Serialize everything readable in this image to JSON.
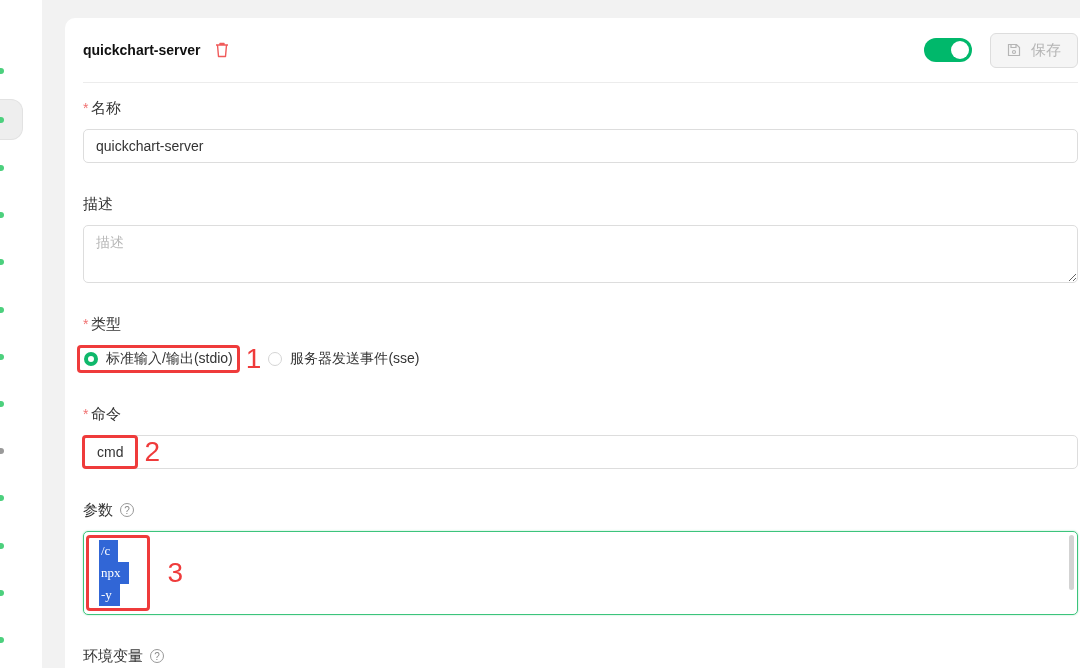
{
  "sidebar": {
    "items": [
      {
        "color": "#4cd07d",
        "selected": false
      },
      {
        "color": "#4cd07d",
        "selected": true
      },
      {
        "color": "#4cd07d",
        "selected": false
      },
      {
        "color": "#4cd07d",
        "selected": false
      },
      {
        "color": "#4cd07d",
        "selected": false
      },
      {
        "color": "#4cd07d",
        "selected": false
      },
      {
        "color": "#4cd07d",
        "selected": false
      },
      {
        "color": "#4cd07d",
        "selected": false
      },
      {
        "color": "#9a9a9a",
        "selected": false
      },
      {
        "color": "#4cd07d",
        "selected": false
      },
      {
        "color": "#4cd07d",
        "selected": false
      },
      {
        "color": "#4cd07d",
        "selected": false
      },
      {
        "color": "#4cd07d",
        "selected": false
      }
    ]
  },
  "server": {
    "title": "quickchart-server",
    "enabled": true,
    "save_button": {
      "label": "保存",
      "disabled": true
    }
  },
  "form": {
    "name": {
      "label": "名称",
      "required": "*",
      "value": "quickchart-server"
    },
    "description": {
      "label": "描述",
      "placeholder": "描述"
    },
    "type": {
      "label": "类型",
      "required": "*",
      "options": [
        {
          "label": "标准输入/输出(stdio)",
          "selected": true,
          "callout": "1"
        },
        {
          "label": "服务器发送事件(sse)",
          "selected": false
        }
      ]
    },
    "command": {
      "label": "命令",
      "required": "*",
      "value": "cmd",
      "callout": "2"
    },
    "args": {
      "label": "参数",
      "help": "?",
      "focused": true,
      "callout": "3",
      "lines": [
        "/c",
        "npx",
        "-y"
      ]
    },
    "env": {
      "label": "环境变量",
      "help": "?"
    }
  }
}
